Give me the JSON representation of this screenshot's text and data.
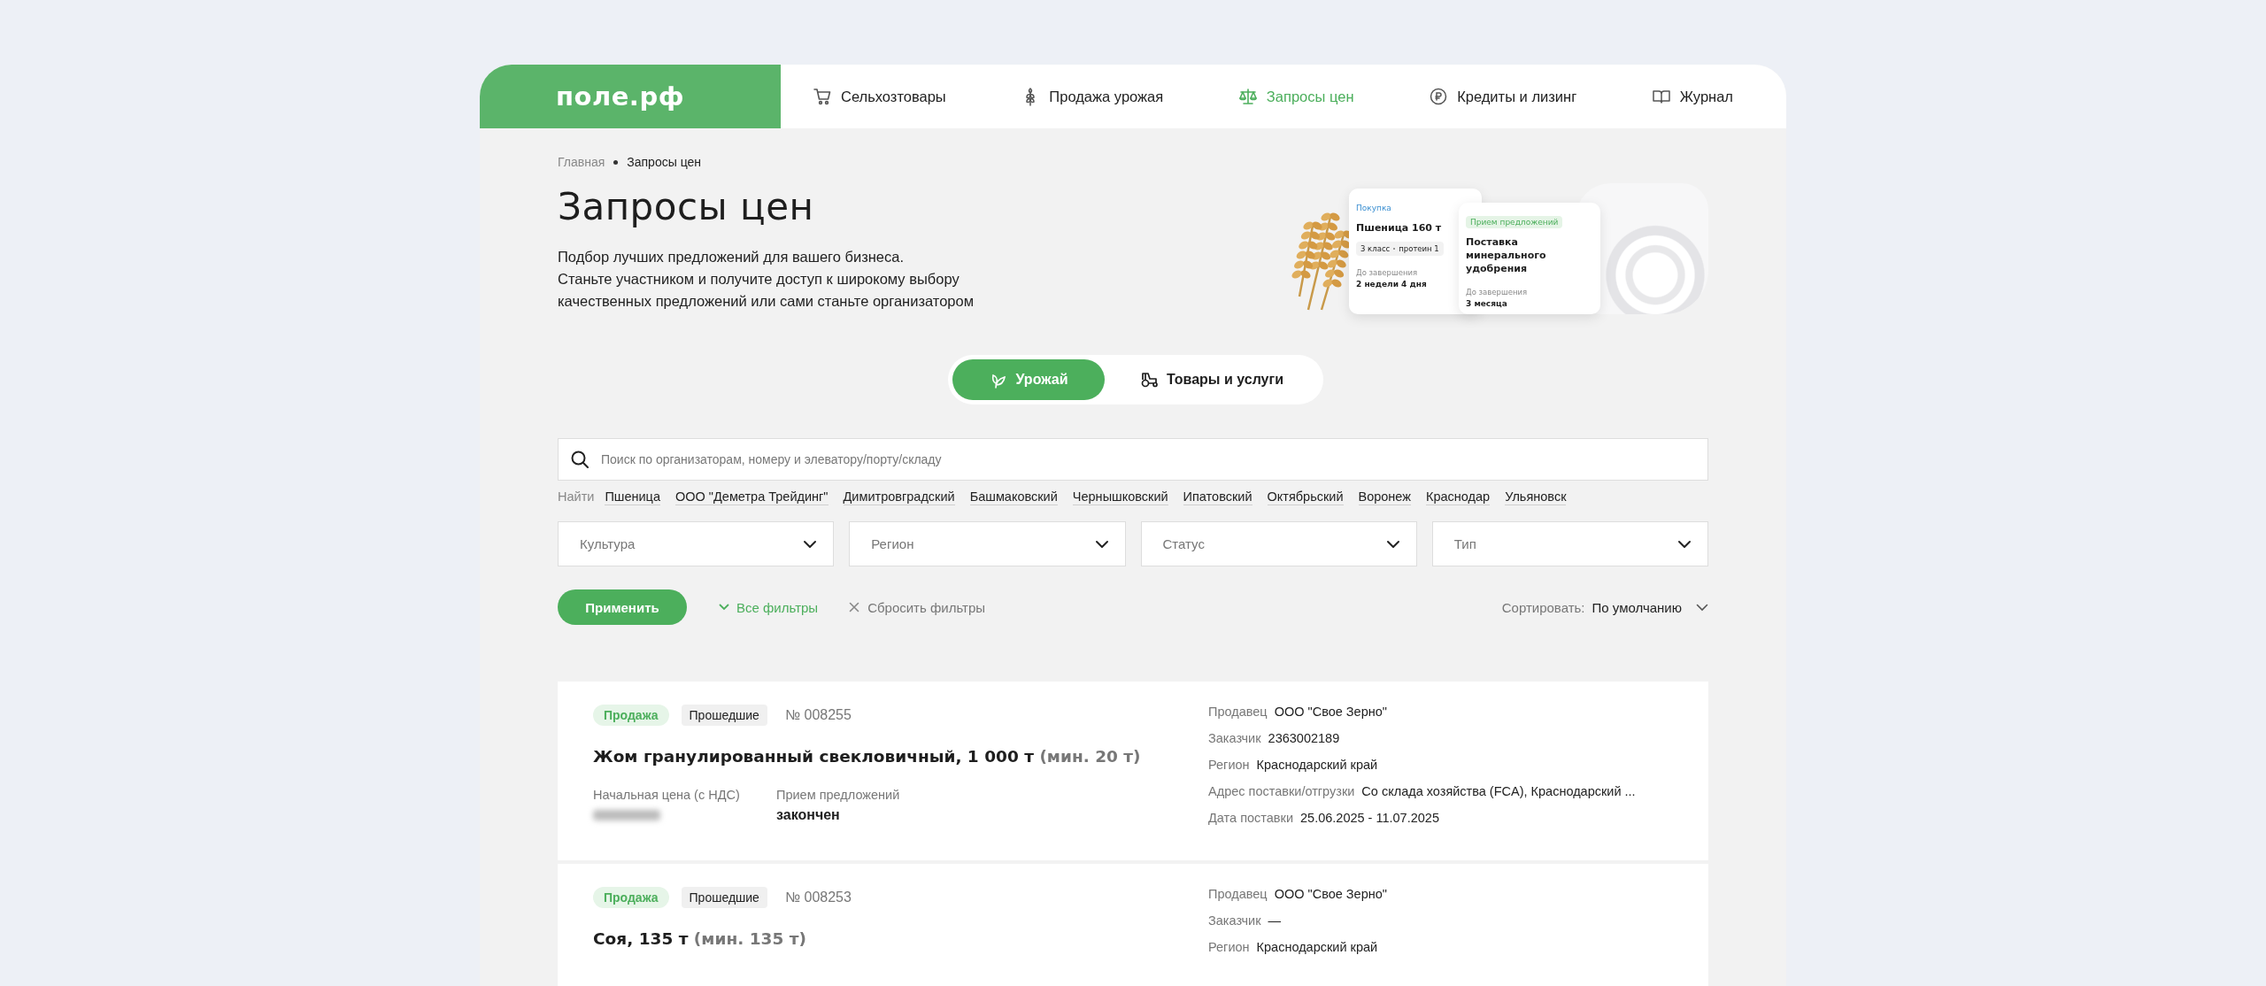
{
  "logo": "поле.рф",
  "nav": [
    {
      "label": "Сельхозтовары",
      "kind": "cart",
      "selected": false
    },
    {
      "label": "Продажа урожая",
      "kind": "wheat",
      "selected": false
    },
    {
      "label": "Запросы цен",
      "kind": "scales",
      "selected": true
    },
    {
      "label": "Кредиты и лизинг",
      "kind": "coin",
      "selected": false
    },
    {
      "label": "Журнал",
      "kind": "book",
      "selected": false
    }
  ],
  "breadcrumbs": [
    {
      "label": "Главная",
      "current": false
    },
    {
      "label": "Запросы цен",
      "current": true
    }
  ],
  "title": "Запросы цен",
  "description_lines": [
    "Подбор лучших предложений для вашего бизнеса.",
    "Станьте участником и получите доступ к широкому выбору",
    "качественных предложений или сами станьте организатором"
  ],
  "hero_cards": [
    {
      "tag": "Покупка",
      "kind": "purchase",
      "name": "Пшеница 160 т",
      "chips": [
        "3 класс",
        "протеин 1"
      ],
      "deadline_label": "До завершения",
      "deadline": "2 недели 4 дня"
    },
    {
      "tag": "Прием предложений",
      "kind": "offers",
      "name": "Поставка минерального удобрения",
      "deadline_label": "До завершения",
      "deadline": "3 месяца"
    }
  ],
  "segments": [
    {
      "label": "Урожай",
      "kind": "sprout",
      "selected": true
    },
    {
      "label": "Товары и услуги",
      "kind": "tractor",
      "selected": false
    }
  ],
  "search": {
    "placeholder": "Поиск по организаторам, номеру и элеватору/порту/складу"
  },
  "quick_search": {
    "label": "Найти",
    "tags": [
      "Пшеница",
      "ООО \"Деметра Трейдинг\"",
      "Димитровградский",
      "Башмаковский",
      "Чернышковский",
      "Ипатовский",
      "Октябрьский",
      "Воронеж",
      "Краснодар",
      "Ульяновск"
    ]
  },
  "filters": [
    {
      "placeholder": "Культура"
    },
    {
      "placeholder": "Регион"
    },
    {
      "placeholder": "Статус"
    },
    {
      "placeholder": "Тип"
    }
  ],
  "actions": {
    "apply": "Применить",
    "all_filters": "Все фильтры",
    "reset": "Сбросить фильтры"
  },
  "sort": {
    "label": "Сортировать:",
    "value": "По умолчанию"
  },
  "requests": [
    {
      "type_badge": "Продажа",
      "status_badge": "Прошедшие",
      "number": "№ 008255",
      "title": "Жом гранулированный свекловичный, 1 000 т",
      "minimum": "(мин. 20 т)",
      "price_label": "Начальная цена (с НДС)",
      "offers_label": "Прием предложений",
      "offers_value": "закончен",
      "details": [
        {
          "label": "Продавец",
          "value": "ООО \"Свое Зерно\""
        },
        {
          "label": "Заказчик",
          "value": "2363002189"
        },
        {
          "label": "Регион",
          "value": "Краснодарский край"
        },
        {
          "label": "Адрес поставки/отгрузки",
          "value": "Со склада хозяйства (FCA), Краснодарский ..."
        },
        {
          "label": "Дата поставки",
          "value": "25.06.2025 - 11.07.2025"
        }
      ]
    },
    {
      "type_badge": "Продажа",
      "status_badge": "Прошедшие",
      "number": "№ 008253",
      "title": "Соя, 135 т",
      "minimum": "(мин. 135 т)",
      "details": [
        {
          "label": "Продавец",
          "value": "ООО \"Свое Зерно\""
        },
        {
          "label": "Заказчик",
          "value": "—"
        },
        {
          "label": "Регион",
          "value": "Краснодарский край"
        }
      ]
    }
  ]
}
